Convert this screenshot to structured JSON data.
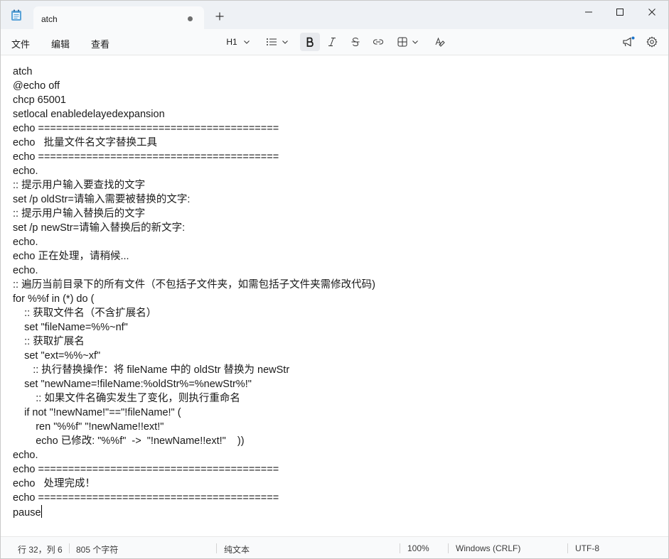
{
  "titlebar": {
    "tab_title": "atch",
    "new_tab_icon": "plus-icon",
    "minimize_icon": "minimize-icon",
    "maximize_icon": "maximize-icon",
    "close_icon": "close-icon"
  },
  "menu": {
    "file": "文件",
    "edit": "编辑",
    "view": "查看"
  },
  "toolbar": {
    "heading_label": "H1",
    "icons": [
      "chevron-down-icon",
      "list-icon",
      "bold-icon",
      "italic-icon",
      "strikethrough-icon",
      "link-icon",
      "table-icon",
      "clear-format-icon",
      "copilot-icon",
      "settings-icon"
    ]
  },
  "editor": {
    "lines": [
      "atch",
      "@echo off",
      "chcp 65001",
      "setlocal enabledelayedexpansion",
      "echo ========================================",
      "echo   批量文件名文字替换工具",
      "echo ========================================",
      "echo.",
      ":: 提示用户输入要查找的文字",
      "set /p oldStr=请输入需要被替换的文字:",
      ":: 提示用户输入替换后的文字",
      "set /p newStr=请输入替换后的新文字:",
      "echo.",
      "echo 正在处理，请稍候...",
      "echo.",
      ":: 遍历当前目录下的所有文件（不包括子文件夹，如需包括子文件夹需修改代码)",
      "for %%f in (*) do (",
      "    :: 获取文件名（不含扩展名）",
      "    set \"fileName=%%~nf\"",
      "    :: 获取扩展名",
      "    set \"ext=%%~xf\"",
      "       :: 执行替换操作：将 fileName 中的 oldStr 替换为 newStr",
      "    set \"newName=!fileName:%oldStr%=%newStr%!\"",
      "        :: 如果文件名确实发生了变化，则执行重命名",
      "    if not \"!newName!\"==\"!fileName!\" (",
      "        ren \"%%f\" \"!newName!!ext!\"",
      "        echo 已修改: \"%%f\"  ->  \"!newName!!ext!\"    ))",
      "echo.",
      "echo ========================================",
      "echo   处理完成！",
      "echo ========================================",
      "pause"
    ]
  },
  "status": {
    "position": "行 32，列 6",
    "char_count": "805 个字符",
    "format": "纯文本",
    "zoom": "100%",
    "line_ending": "Windows (CRLF)",
    "encoding": "UTF-8"
  }
}
